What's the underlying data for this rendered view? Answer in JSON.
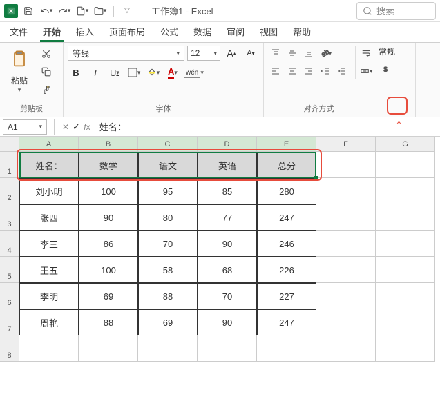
{
  "titlebar": {
    "title": "工作簿1 - Excel",
    "search_placeholder": "搜索"
  },
  "tabs": [
    "文件",
    "开始",
    "插入",
    "页面布局",
    "公式",
    "数据",
    "审阅",
    "视图",
    "帮助"
  ],
  "active_tab": 1,
  "ribbon": {
    "clipboard": {
      "paste": "粘贴",
      "label": "剪贴板"
    },
    "font": {
      "name": "等线",
      "size": "12",
      "label": "字体"
    },
    "alignment": {
      "label": "对齐方式"
    },
    "number": {
      "label": "常规"
    }
  },
  "formula_bar": {
    "name_box": "A1",
    "value": "姓名："
  },
  "columns": [
    "A",
    "B",
    "C",
    "D",
    "E",
    "F",
    "G"
  ],
  "chart_data": {
    "type": "table",
    "title": "",
    "headers": [
      "姓名：",
      "数学",
      "语文",
      "英语",
      "总分"
    ],
    "rows": [
      [
        "刘小明",
        100,
        95,
        85,
        280
      ],
      [
        "张四",
        90,
        80,
        77,
        247
      ],
      [
        "李三",
        86,
        70,
        90,
        246
      ],
      [
        "王五",
        100,
        58,
        68,
        226
      ],
      [
        "李明",
        69,
        88,
        70,
        227
      ],
      [
        "周艳",
        88,
        69,
        90,
        247
      ]
    ]
  }
}
